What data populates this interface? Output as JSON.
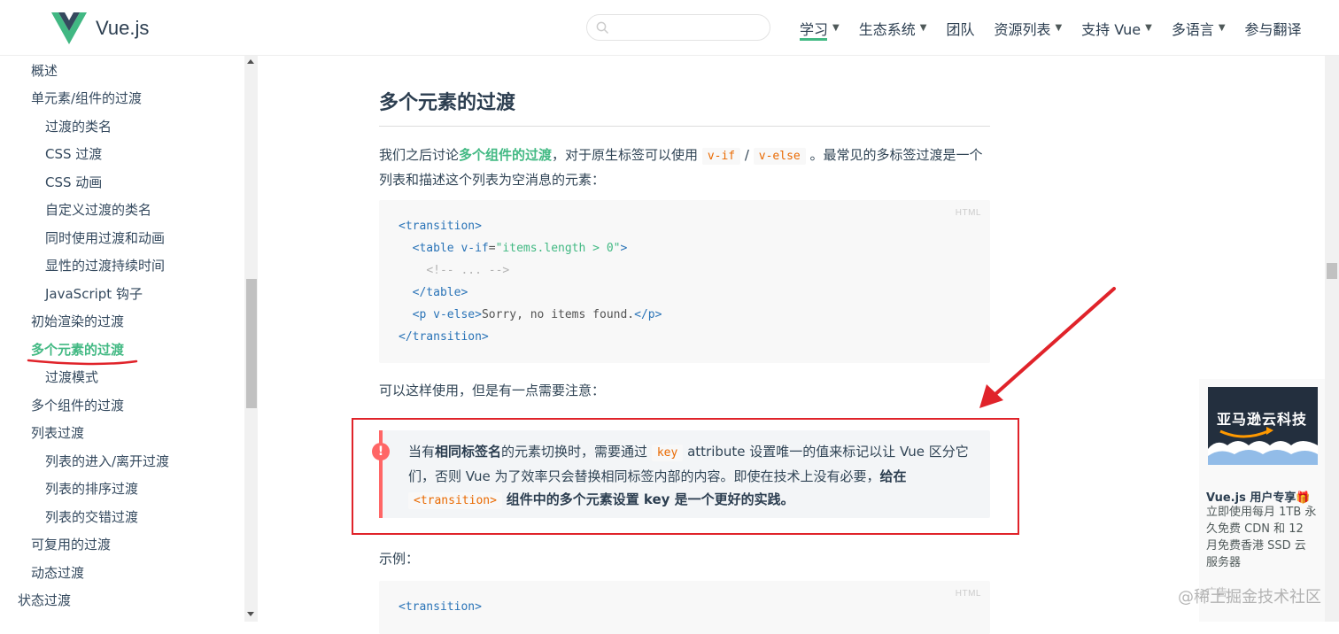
{
  "header": {
    "logo_text": "Vue.js",
    "search_placeholder": "",
    "nav": [
      {
        "label": "学习",
        "dropdown": true,
        "active": true
      },
      {
        "label": "生态系统",
        "dropdown": true
      },
      {
        "label": "团队",
        "dropdown": false
      },
      {
        "label": "资源列表",
        "dropdown": true
      },
      {
        "label": "支持 Vue",
        "dropdown": true
      },
      {
        "label": "多语言",
        "dropdown": true
      },
      {
        "label": "参与翻译",
        "dropdown": false
      }
    ]
  },
  "sidebar": {
    "items": [
      {
        "label": "概述",
        "level": 1
      },
      {
        "label": "单元素/组件的过渡",
        "level": 1
      },
      {
        "label": "过渡的类名",
        "level": 2
      },
      {
        "label": "CSS 过渡",
        "level": 2
      },
      {
        "label": "CSS 动画",
        "level": 2
      },
      {
        "label": "自定义过渡的类名",
        "level": 2
      },
      {
        "label": "同时使用过渡和动画",
        "level": 2
      },
      {
        "label": "显性的过渡持续时间",
        "level": 2
      },
      {
        "label": "JavaScript 钩子",
        "level": 2
      },
      {
        "label": "初始渲染的过渡",
        "level": 1
      },
      {
        "label": "多个元素的过渡",
        "level": 1,
        "active": true
      },
      {
        "label": "过渡模式",
        "level": 2
      },
      {
        "label": "多个组件的过渡",
        "level": 1
      },
      {
        "label": "列表过渡",
        "level": 1
      },
      {
        "label": "列表的进入/离开过渡",
        "level": 2
      },
      {
        "label": "列表的排序过渡",
        "level": 2
      },
      {
        "label": "列表的交错过渡",
        "level": 2
      },
      {
        "label": "可复用的过渡",
        "level": 1
      },
      {
        "label": "动态过渡",
        "level": 1
      },
      {
        "label": "状态过渡",
        "level": 0
      }
    ]
  },
  "content": {
    "heading": "多个元素的过渡",
    "intro_prefix": "我们之后讨论",
    "intro_link": "多个组件的过渡",
    "intro_mid": "，对于原生标签可以使用",
    "intro_code1": "v-if",
    "intro_slash": "/",
    "intro_code2": "v-else",
    "intro_suffix": "。最常见的多标签过渡是一个列表和描述这个列表为空消息的元素：",
    "code1_lang": "HTML",
    "usage_text": "可以这样使用，但是有一点需要注意：",
    "tip": {
      "icon": "!",
      "p1": "当有",
      "b1": "相同标签名",
      "p2": "的元素切换时，需要通过",
      "code1": "key",
      "p3": "attribute 设置唯一的值来标记以让 Vue 区分它们，否则 Vue 为了效率只会替换相同标签内部的内容。即使在技术上没有必要，",
      "b2": "给在",
      "code2": "<transition>",
      "b3": "组件中的多个元素设置 key 是一个更好的实践。"
    },
    "example_label": "示例：",
    "code2_lang": "HTML",
    "code2_first": "<transition>"
  },
  "ad": {
    "image_title": "亚马逊云科技",
    "title": "Vue.js 用户专享🎁",
    "desc": "立即使用每月 1TB 永久免费 CDN 和 12 月免费香港 SSD 云服务器",
    "more": "广告"
  },
  "watermark": "@稀土掘金技术社区",
  "colors": {
    "accent": "#42b983",
    "tip_red": "#ff6666",
    "annotation_red": "#e0232a"
  }
}
